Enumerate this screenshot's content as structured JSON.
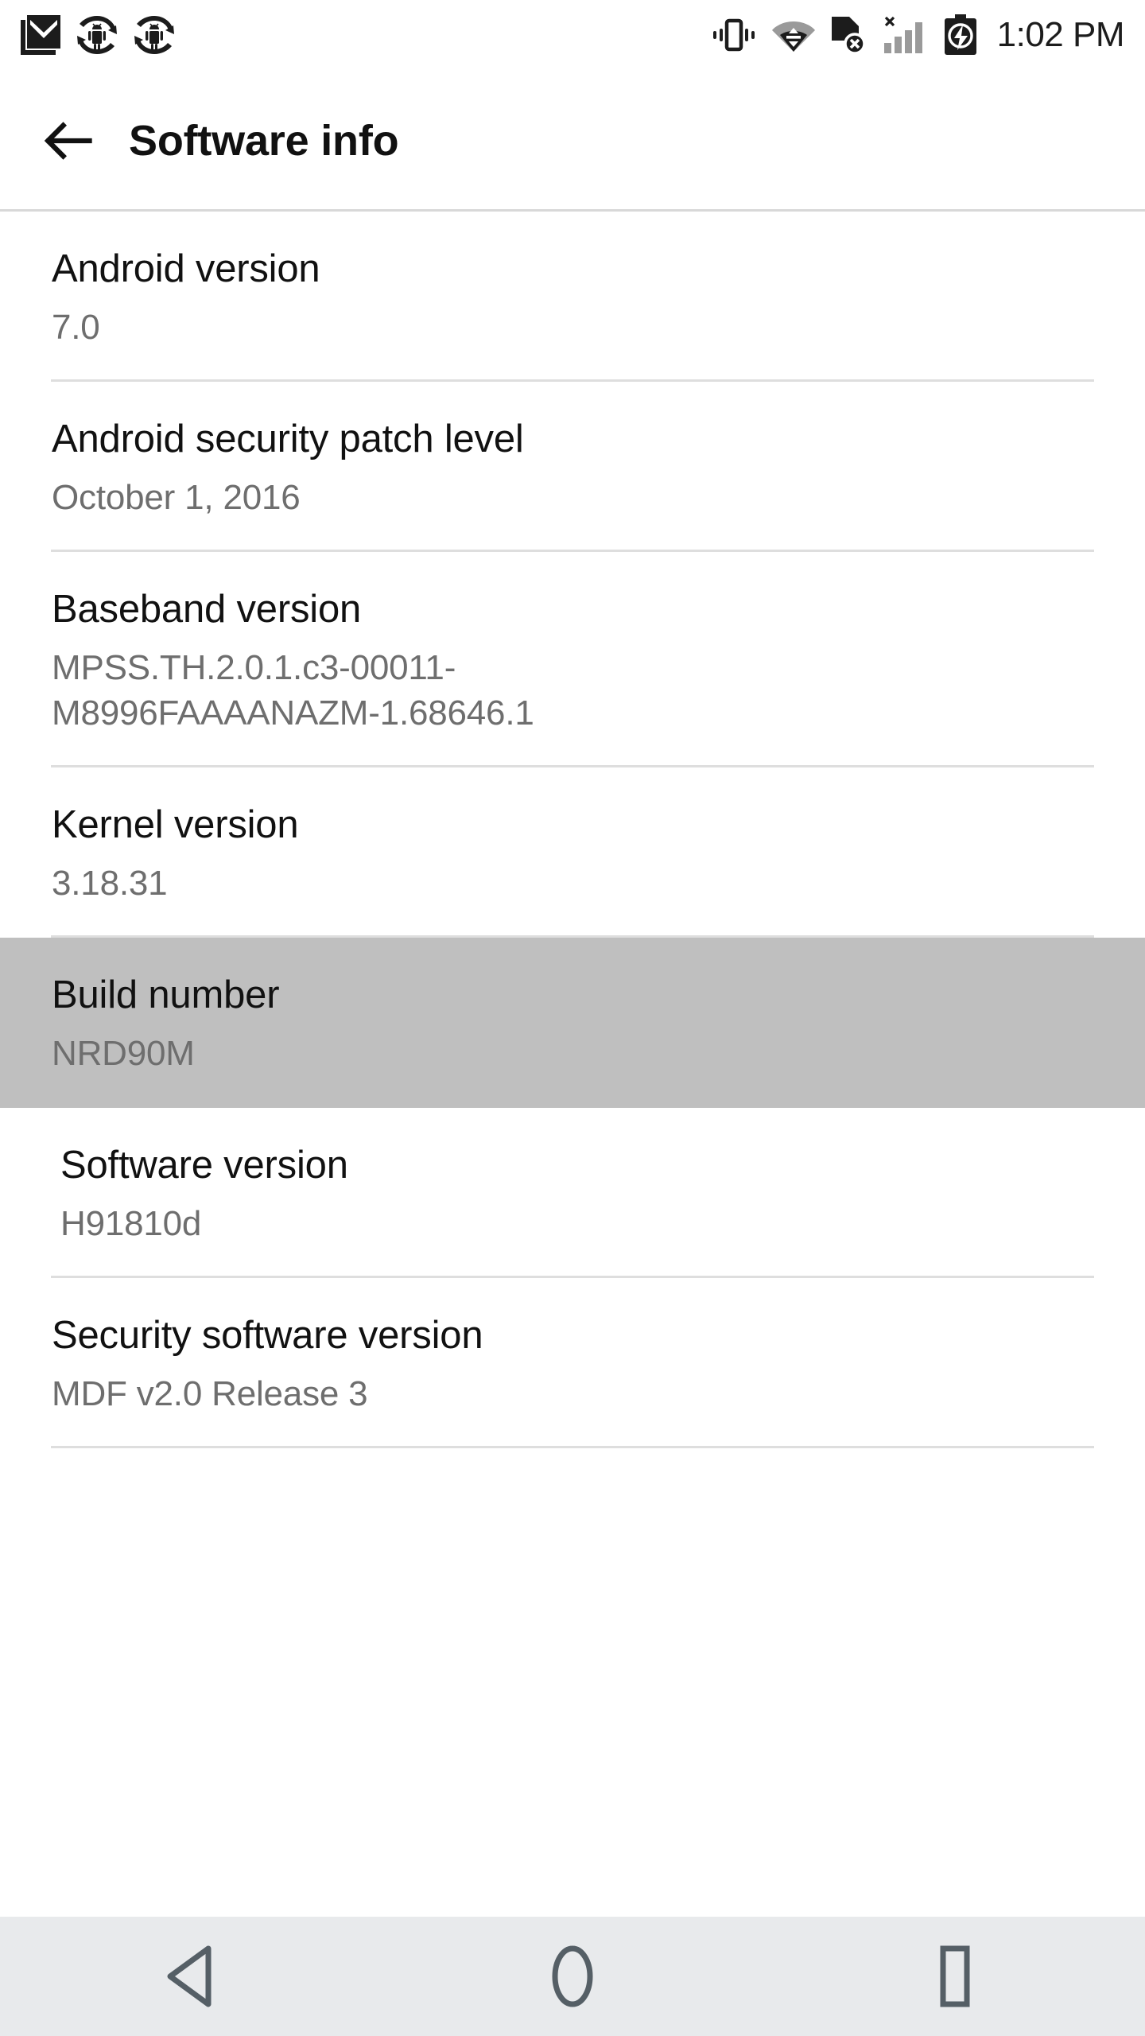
{
  "statusbar": {
    "time": "1:02 PM",
    "left_icons": [
      "gmail-icon",
      "android-sync-icon",
      "android-sync-icon"
    ],
    "right_icons": [
      "vibrate-icon",
      "wifi-icon",
      "sim-card-error-icon",
      "signal-bars-icon",
      "battery-charging-icon"
    ],
    "icon_color": "#1c1c1c"
  },
  "appbar": {
    "back_icon": "back-arrow-icon",
    "title": "Software info"
  },
  "list": {
    "selected_index": 4,
    "highlight_color": "#bfbfbf",
    "items": [
      {
        "title": "Android version",
        "value": "7.0"
      },
      {
        "title": "Android security patch level",
        "value": "October 1, 2016"
      },
      {
        "title": "Baseband version",
        "value": "MPSS.TH.2.0.1.c3-00011-\nM8996FAAAANAZM-1.68646.1"
      },
      {
        "title": "Kernel version",
        "value": "3.18.31"
      },
      {
        "title": "Build number",
        "value": "NRD90M"
      },
      {
        "title": "Software version",
        "value": "H91810d"
      },
      {
        "title": "Security software version",
        "value": "MDF v2.0 Release 3"
      }
    ]
  },
  "navbar": {
    "back_label": "back-triangle-icon",
    "home_label": "home-circle-icon",
    "recents_label": "recents-square-icon",
    "icon_color": "#555f66",
    "background": "#e8eaec"
  }
}
